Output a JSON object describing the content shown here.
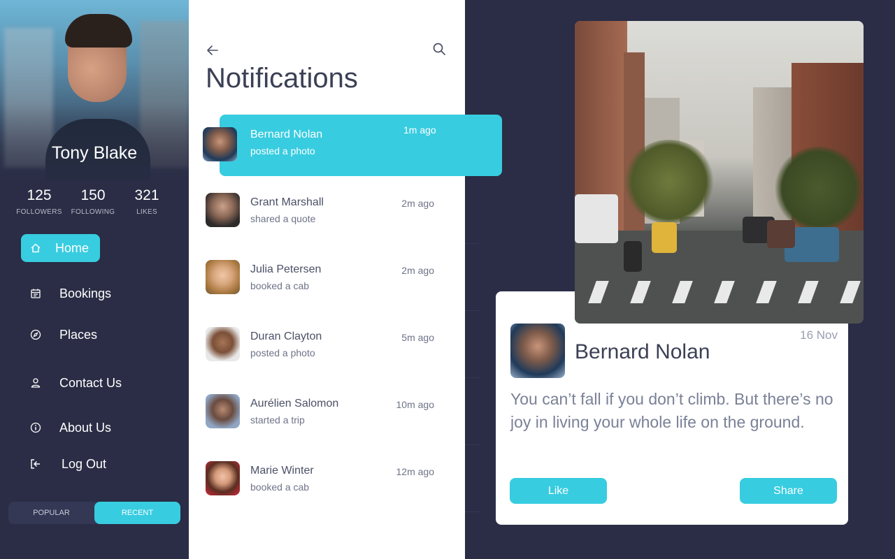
{
  "profile": {
    "name": "Tony Blake",
    "stats": [
      {
        "value": "125",
        "label": "FOLLOWERS"
      },
      {
        "value": "150",
        "label": "FOLLOWING"
      },
      {
        "value": "321",
        "label": "LIKES"
      }
    ]
  },
  "nav": {
    "items": [
      {
        "label": "Home",
        "icon": "home-icon",
        "active": true
      },
      {
        "label": "Bookings",
        "icon": "calendar-icon"
      },
      {
        "label": "Places",
        "icon": "compass-icon"
      },
      {
        "label": "Contact Us",
        "icon": "user-icon"
      },
      {
        "label": "About Us",
        "icon": "info-icon"
      },
      {
        "label": "Log Out",
        "icon": "logout-icon"
      }
    ]
  },
  "toggle": {
    "popular": "POPULAR",
    "recent": "RECENT",
    "selected": "RECENT"
  },
  "notifications": {
    "title": "Notifications",
    "items": [
      {
        "name": "Bernard Nolan",
        "action": "posted a photo",
        "time": "1m ago",
        "highlighted": true
      },
      {
        "name": "Grant Marshall",
        "action": "shared a quote",
        "time": "2m ago"
      },
      {
        "name": "Julia Petersen",
        "action": "booked a cab",
        "time": "2m ago"
      },
      {
        "name": "Duran Clayton",
        "action": "posted a photo",
        "time": "5m ago"
      },
      {
        "name": "Aurélien Salomon",
        "action": "started a trip",
        "time": "10m ago"
      },
      {
        "name": "Marie Winter",
        "action": "booked a cab",
        "time": "12m ago"
      }
    ]
  },
  "post": {
    "name": "Bernard Nolan",
    "date": "16 Nov",
    "quote": "You can’t fall if you don’t climb. But there’s no joy in living your whole life on the ground.",
    "like_label": "Like",
    "share_label": "Share"
  },
  "colors": {
    "accent": "#38cce0",
    "background": "#2a2d45",
    "panel": "#ffffff"
  }
}
